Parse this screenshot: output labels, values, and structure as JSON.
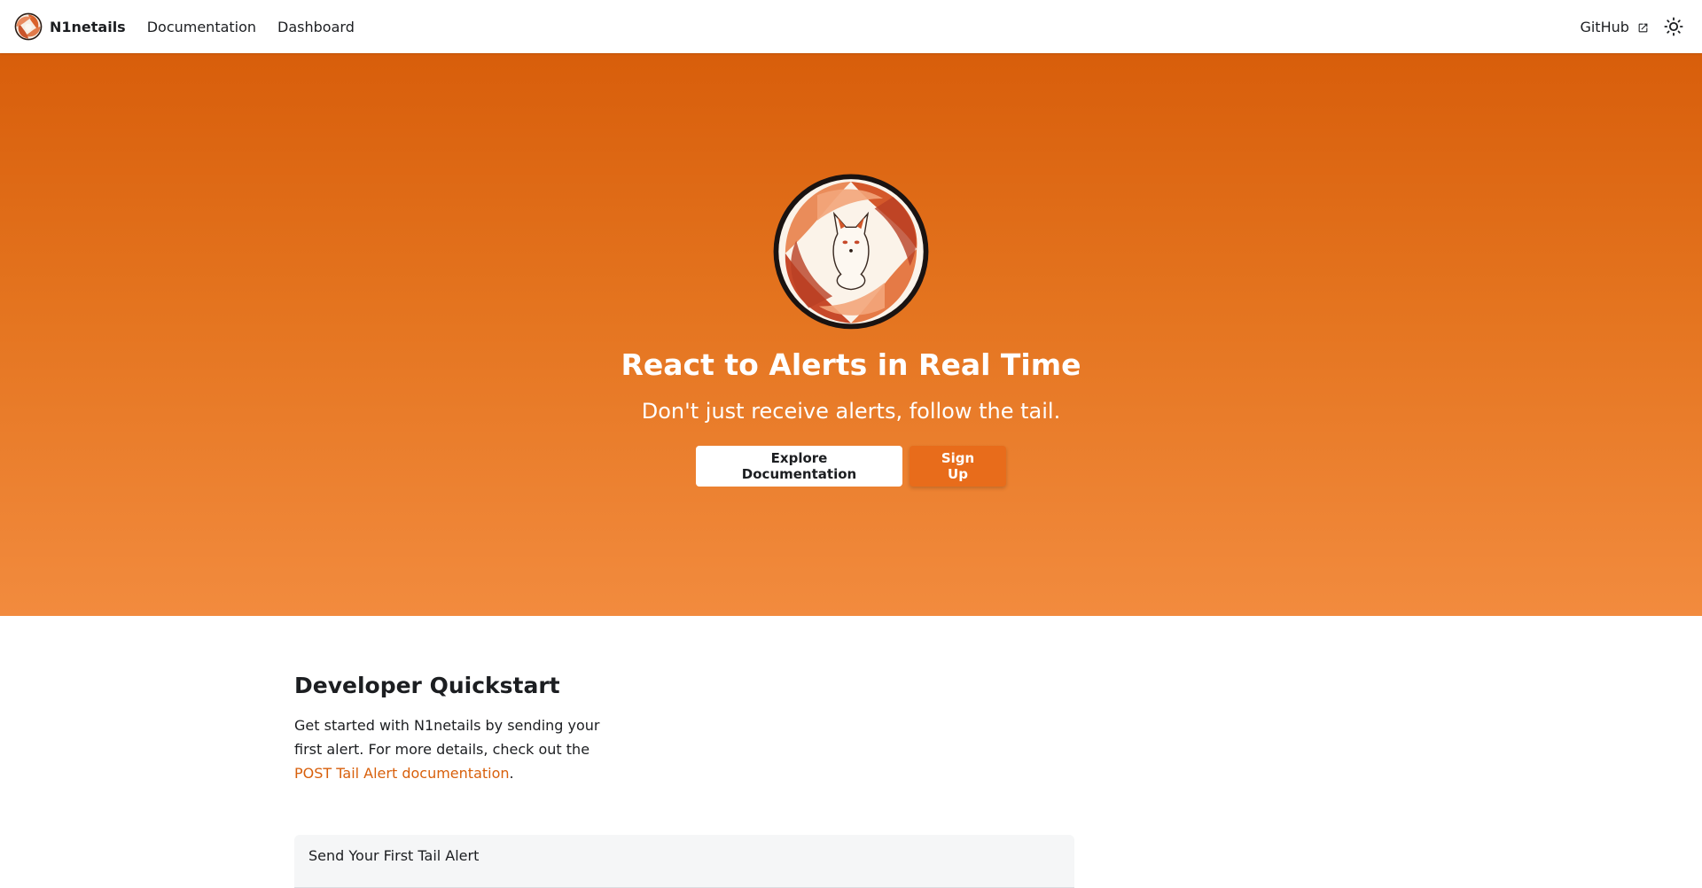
{
  "navbar": {
    "brand": "N1netails",
    "links": [
      "Documentation",
      "Dashboard"
    ],
    "github": "GitHub",
    "icons": {
      "external": "external-link-icon",
      "theme": "sun-icon"
    }
  },
  "hero": {
    "title": "React to Alerts in Real Time",
    "subtitle": "Don't just receive alerts, follow the tail.",
    "primary_button": "Explore Documentation",
    "secondary_button": "Sign Up",
    "colors": {
      "top": "#d85e0b",
      "bottom": "#f28b3e",
      "accent": "#e86c1b"
    }
  },
  "quickstart": {
    "title": "Developer Quickstart",
    "text_before": "Get started with N1netails by sending your first alert. For more details, check out the ",
    "link": "POST Tail Alert documentation",
    "text_after": ".",
    "card_title": "Send Your First Tail Alert"
  }
}
